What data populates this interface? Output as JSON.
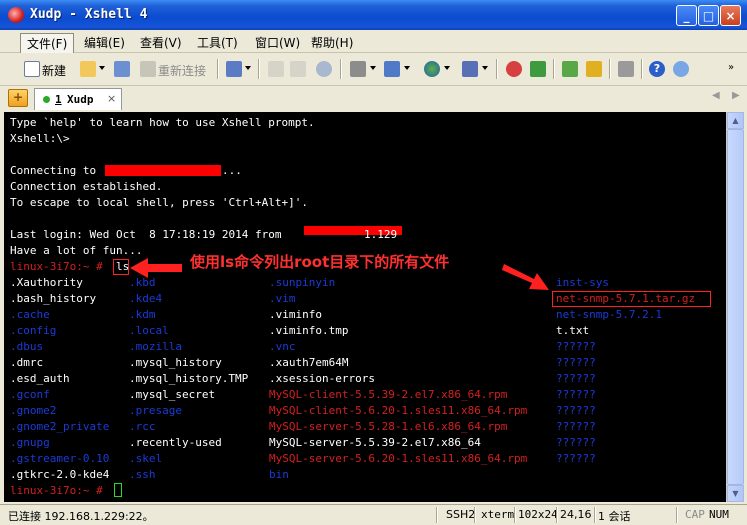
{
  "window": {
    "title": "Xudp - Xshell 4"
  },
  "menu": [
    "文件(F)",
    "编辑(E)",
    "查看(V)",
    "工具(T)",
    "窗口(W)",
    "帮助(H)"
  ],
  "toolbar": {
    "new_label": "新建",
    "reconnect_label": "重新连接"
  },
  "tab": {
    "number": "1",
    "name": "Xudp",
    "close": "×"
  },
  "terminal": {
    "lines": [
      "Type `help' to learn how to use Xshell prompt.",
      "Xshell:\\>",
      "",
      "Connecting to",
      "Connection established.",
      "To escape to local shell, press 'Ctrl+Alt+]'.",
      "",
      "Last login: Wed Oct  8 17:18:19 2014 from",
      "Have a lot of fun..."
    ],
    "connect_ellipsis": "...",
    "login_ip_tail": "1.129",
    "prompt": "linux-3i7o:~ #",
    "command": "ls",
    "annotation": "使用ls命令列出root目录下的所有文件",
    "columns": [
      [
        {
          "t": ".Xauthority",
          "c": "w"
        },
        {
          "t": ".bash_history",
          "c": "w"
        },
        {
          "t": ".cache",
          "c": "b"
        },
        {
          "t": ".config",
          "c": "b"
        },
        {
          "t": ".dbus",
          "c": "b"
        },
        {
          "t": ".dmrc",
          "c": "w"
        },
        {
          "t": ".esd_auth",
          "c": "w"
        },
        {
          "t": ".gconf",
          "c": "b"
        },
        {
          "t": ".gnome2",
          "c": "b"
        },
        {
          "t": ".gnome2_private",
          "c": "b"
        },
        {
          "t": ".gnupg",
          "c": "b"
        },
        {
          "t": ".gstreamer-0.10",
          "c": "b"
        },
        {
          "t": ".gtkrc-2.0-kde4",
          "c": "w"
        }
      ],
      [
        {
          "t": ".kbd",
          "c": "b"
        },
        {
          "t": ".kde4",
          "c": "b"
        },
        {
          "t": ".kdm",
          "c": "b"
        },
        {
          "t": ".local",
          "c": "b"
        },
        {
          "t": ".mozilla",
          "c": "b"
        },
        {
          "t": ".mysql_history",
          "c": "w"
        },
        {
          "t": ".mysql_history.TMP",
          "c": "w"
        },
        {
          "t": ".mysql_secret",
          "c": "w"
        },
        {
          "t": ".presage",
          "c": "b"
        },
        {
          "t": ".rcc",
          "c": "b"
        },
        {
          "t": ".recently-used",
          "c": "w"
        },
        {
          "t": ".skel",
          "c": "b"
        },
        {
          "t": ".ssh",
          "c": "b"
        }
      ],
      [
        {
          "t": ".sunpinyin",
          "c": "b"
        },
        {
          "t": ".vim",
          "c": "b"
        },
        {
          "t": ".viminfo",
          "c": "w"
        },
        {
          "t": ".viminfo.tmp",
          "c": "w"
        },
        {
          "t": ".vnc",
          "c": "b"
        },
        {
          "t": ".xauth7em64M",
          "c": "w"
        },
        {
          "t": ".xsession-errors",
          "c": "w"
        },
        {
          "t": "MySQL-client-5.5.39-2.el7.x86_64.rpm",
          "c": "r"
        },
        {
          "t": "MySQL-client-5.6.20-1.sles11.x86_64.rpm",
          "c": "r"
        },
        {
          "t": "MySQL-server-5.5.28-1.el6.x86_64.rpm",
          "c": "r"
        },
        {
          "t": "MySQL-server-5.5.39-2.el7.x86_64",
          "c": "w"
        },
        {
          "t": "MySQL-server-5.6.20-1.sles11.x86_64.rpm",
          "c": "r"
        },
        {
          "t": "bin",
          "c": "b"
        }
      ],
      [
        {
          "t": "inst-sys",
          "c": "b"
        },
        {
          "t": "net-snmp-5.7.1.tar.gz",
          "c": "r"
        },
        {
          "t": "net-snmp-5.7.2.1",
          "c": "b"
        },
        {
          "t": "t.txt",
          "c": "w"
        },
        {
          "t": "??????",
          "c": "b"
        },
        {
          "t": "??????",
          "c": "b"
        },
        {
          "t": "??????",
          "c": "b"
        },
        {
          "t": "??????",
          "c": "b"
        },
        {
          "t": "??????",
          "c": "b"
        },
        {
          "t": "??????",
          "c": "b"
        },
        {
          "t": "??????",
          "c": "b"
        },
        {
          "t": "??????",
          "c": "b"
        }
      ]
    ],
    "final_prompt": "linux-3i7o:~ #"
  },
  "status": {
    "connection": "已连接 192.168.1.229:22。",
    "protocol": "SSH2",
    "term": "xterm",
    "size": "102x24",
    "cursor": "24,16",
    "sessions": "1 会话",
    "caps": "CAP",
    "num": "NUM"
  },
  "colors": {
    "terminal_bg": "#000000",
    "prompt": "#d22020",
    "directory": "#1a3bd6",
    "annotation": "#ff3030"
  }
}
